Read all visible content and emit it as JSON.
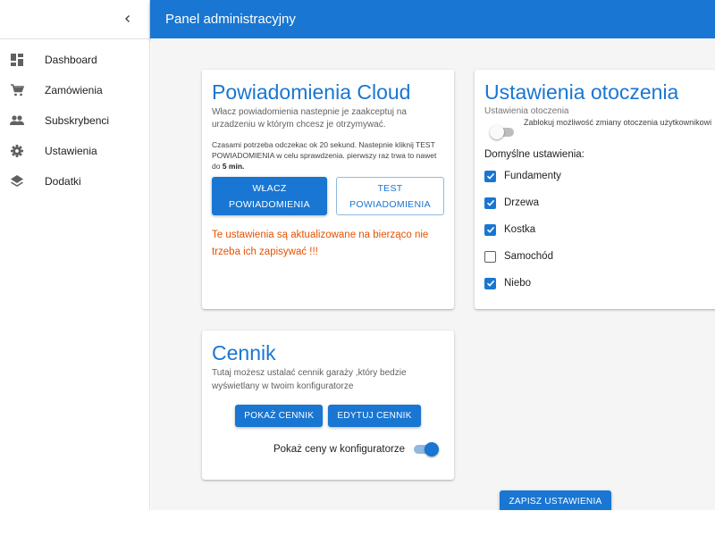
{
  "header": {
    "title": "Panel administracyjny"
  },
  "sidebar": {
    "collapse_icon": "chevron-left-icon",
    "items": [
      {
        "label": "Dashboard",
        "icon": "dashboard-icon"
      },
      {
        "label": "Zamówienia",
        "icon": "cart-icon"
      },
      {
        "label": "Subskrybenci",
        "icon": "people-icon"
      },
      {
        "label": "Ustawienia",
        "icon": "gear-icon"
      },
      {
        "label": "Dodatki",
        "icon": "layers-icon"
      }
    ]
  },
  "notifications": {
    "title": "Powiadomienia Cloud",
    "description": "Włacz powiadomienia nastepnie je zaakceptuj na urzadzeniu w którym chcesz je otrzymywać.",
    "note_text": "Czasami potrzeba odczekac ok 20 sekund. Nastepnie kliknij TEST POWIADOMIENIA w celu sprawdzenia. pierwszy raz trwa to nawet do ",
    "note_bold": "5 min.",
    "enable_button": "WŁACZ POWIADOMIENIA",
    "test_button": "TEST POWIADOMIENIA",
    "warning": "Te ustawienia są aktualizowane na bierząco nie trzeba ich zapisywać !!!"
  },
  "environment": {
    "title": "Ustawienia otoczenia",
    "subtitle": "Ustawienia otoczenia",
    "lock_toggle_label": "Zablokuj możliwość zmiany otoczenia użytkownikowi",
    "lock_toggle_on": false,
    "defaults_label": "Domyślne ustawienia:",
    "options": [
      {
        "label": "Fundamenty",
        "checked": true
      },
      {
        "label": "Drzewa",
        "checked": true
      },
      {
        "label": "Kostka",
        "checked": true
      },
      {
        "label": "Samochód",
        "checked": false
      },
      {
        "label": "Niebo",
        "checked": true
      }
    ]
  },
  "pricing": {
    "title": "Cennik",
    "description": "Tutaj możesz ustalać cennik garaży ,który bedzie wyświetlany w twoim konfiguratorze",
    "show_button": "POKAŻ CENNIK",
    "edit_button": "EDYTUJ CENNIK",
    "show_prices_label": "Pokaż ceny w konfiguratorze",
    "show_prices_on": true
  },
  "save_button": "ZAPISZ USTAWIENIA",
  "colors": {
    "primary": "#1976d2",
    "warning": "#e65100",
    "background": "#f5f5f5"
  }
}
